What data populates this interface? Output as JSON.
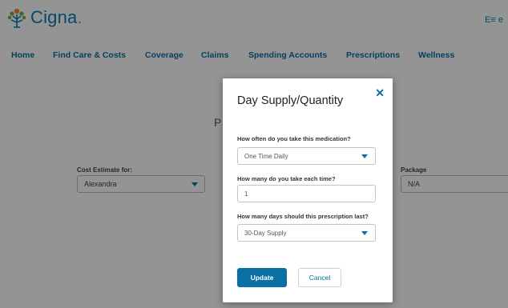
{
  "brand": {
    "name": "Cigna",
    "dot": ".",
    "accent": "#0a7fb5",
    "logo_icon": "tree-icon"
  },
  "header": {
    "icon": "profile-card-icon",
    "icon_text": "E≡ e"
  },
  "nav": {
    "items": [
      {
        "label": "Home"
      },
      {
        "label": "Find Care & Costs"
      },
      {
        "label": "Coverage"
      },
      {
        "label": "Claims"
      },
      {
        "label": "Spending Accounts"
      },
      {
        "label": "Prescriptions"
      },
      {
        "label": "Wellness"
      }
    ]
  },
  "background": {
    "heading_fragment": "P",
    "cost_estimate": {
      "label": "Cost Estimate for:",
      "value": "Alexandra"
    },
    "package": {
      "label": "Package",
      "value": "N/A"
    }
  },
  "modal": {
    "title": "Day Supply/Quantity",
    "close_glyph": "✕",
    "frequency": {
      "label": "How often do you take this medication?",
      "value": "One Time Daily"
    },
    "quantity": {
      "label": "How many do you take each time?",
      "value": "1"
    },
    "duration": {
      "label": "How many days should this prescription last?",
      "value": "30-Day Supply"
    },
    "update_label": "Update",
    "cancel_label": "Cancel"
  }
}
